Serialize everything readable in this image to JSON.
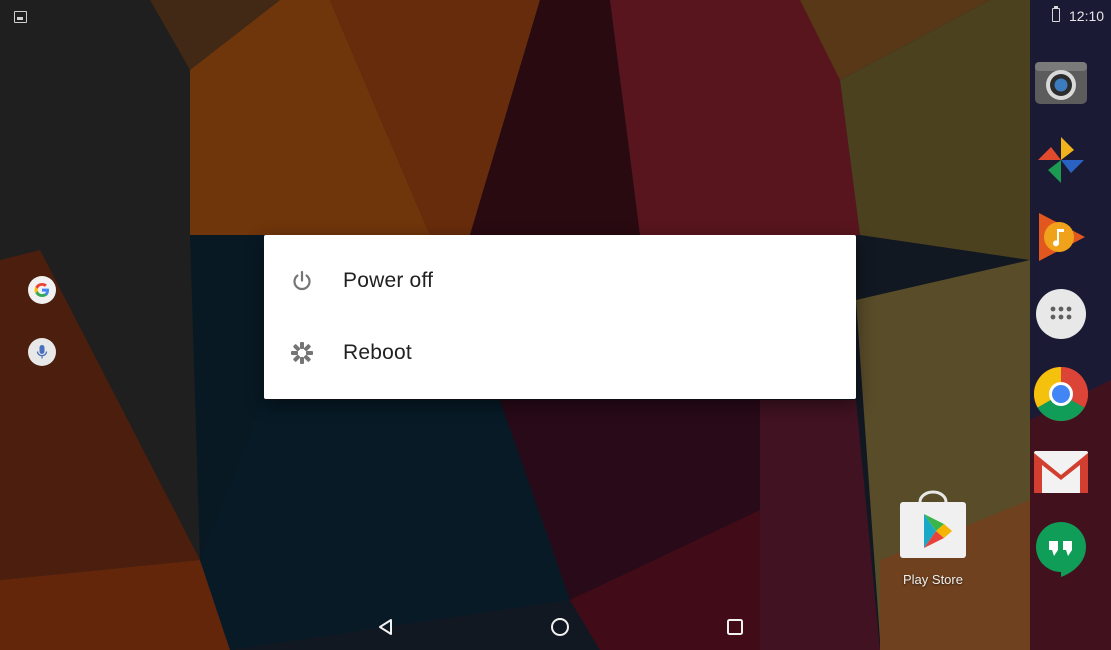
{
  "status_bar": {
    "time": "12:10",
    "icons": [
      "gallery-icon",
      "battery-charging-icon"
    ]
  },
  "left_rail": {
    "icons": [
      "google-search-icon",
      "voice-search-icon"
    ]
  },
  "dock": {
    "apps": [
      "camera-icon",
      "photos-icon",
      "play-music-icon",
      "all-apps-icon",
      "chrome-icon",
      "gmail-icon",
      "hangouts-icon"
    ]
  },
  "desktop": {
    "play_store_label": "Play Store"
  },
  "power_menu": {
    "items": [
      {
        "label": "Power off",
        "icon": "power-icon"
      },
      {
        "label": "Reboot",
        "icon": "reboot-icon"
      }
    ]
  },
  "nav_bar": {
    "buttons": [
      "back-icon",
      "home-icon",
      "recents-icon"
    ]
  },
  "colors": {
    "dialog_bg": "#ffffff",
    "dialog_text": "#212121",
    "dialog_icon": "#757575"
  }
}
